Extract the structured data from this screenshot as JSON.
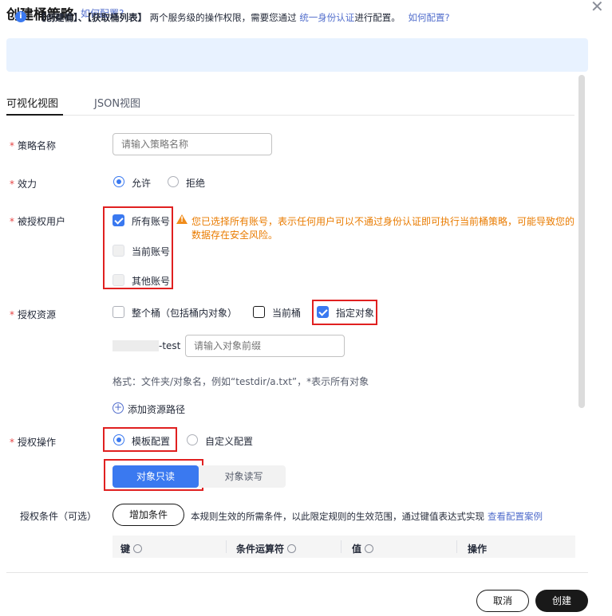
{
  "header": {
    "title": "创建桶策略",
    "howto_link": "如何配置?"
  },
  "info": {
    "part1": "【创建桶】、【获取桶列表】",
    "part2": "两个服务级的操作权限，需要您通过",
    "link1": "统一身份认证",
    "part3": "进行配置。",
    "link2": "如何配置?"
  },
  "tabs": [
    {
      "label": "可视化视图",
      "active": true
    },
    {
      "label": "JSON视图",
      "active": false
    }
  ],
  "form": {
    "policy_name": {
      "label": "策略名称",
      "placeholder": "请输入策略名称",
      "value": ""
    },
    "effect": {
      "label": "效力",
      "options": [
        "允许",
        "拒绝"
      ],
      "selected": "允许"
    },
    "principal": {
      "label": "被授权用户",
      "options": [
        {
          "label": "所有账号",
          "checked": true,
          "disabled": false
        },
        {
          "label": "当前账号",
          "checked": false,
          "disabled": true
        },
        {
          "label": "其他账号",
          "checked": false,
          "disabled": true
        }
      ],
      "warning": "您已选择所有账号，表示任何用户可以不通过身份认证即可执行当前桶策略，可能导致您的数据存在安全风险。"
    },
    "resource": {
      "label": "授权资源",
      "options": [
        {
          "label": "整个桶（包括桶内对象）",
          "checked": false
        },
        {
          "label": "当前桶",
          "checked": false
        },
        {
          "label": "指定对象",
          "checked": true
        }
      ],
      "bucket_suffix": "-test",
      "prefix_placeholder": "请输入对象前缀",
      "format_hint": "格式：文件夹/对象名，例如“testdir/a.txt”，*表示所有对象",
      "add_path": "添加资源路径"
    },
    "action": {
      "label": "授权操作",
      "options": [
        "模板配置",
        "自定义配置"
      ],
      "selected": "模板配置",
      "templates": [
        "对象只读",
        "对象读写"
      ],
      "selected_template": "对象只读"
    },
    "condition": {
      "label": "授权条件（可选）",
      "add_button": "增加条件",
      "desc": "本规则生效的所需条件，以此限定规则的生效范围，通过键值表达式实现",
      "example_link": "查看配置案例",
      "columns": [
        "键",
        "条件运算符",
        "值",
        "操作"
      ]
    }
  },
  "footer": {
    "cancel": "取消",
    "create": "创建"
  },
  "colors": {
    "primary": "#3a79f0",
    "link": "#526ecc",
    "required": "#e54545",
    "warning": "#e97b00",
    "highlight_box": "#e02020",
    "info_bg": "#e8f2ff"
  }
}
